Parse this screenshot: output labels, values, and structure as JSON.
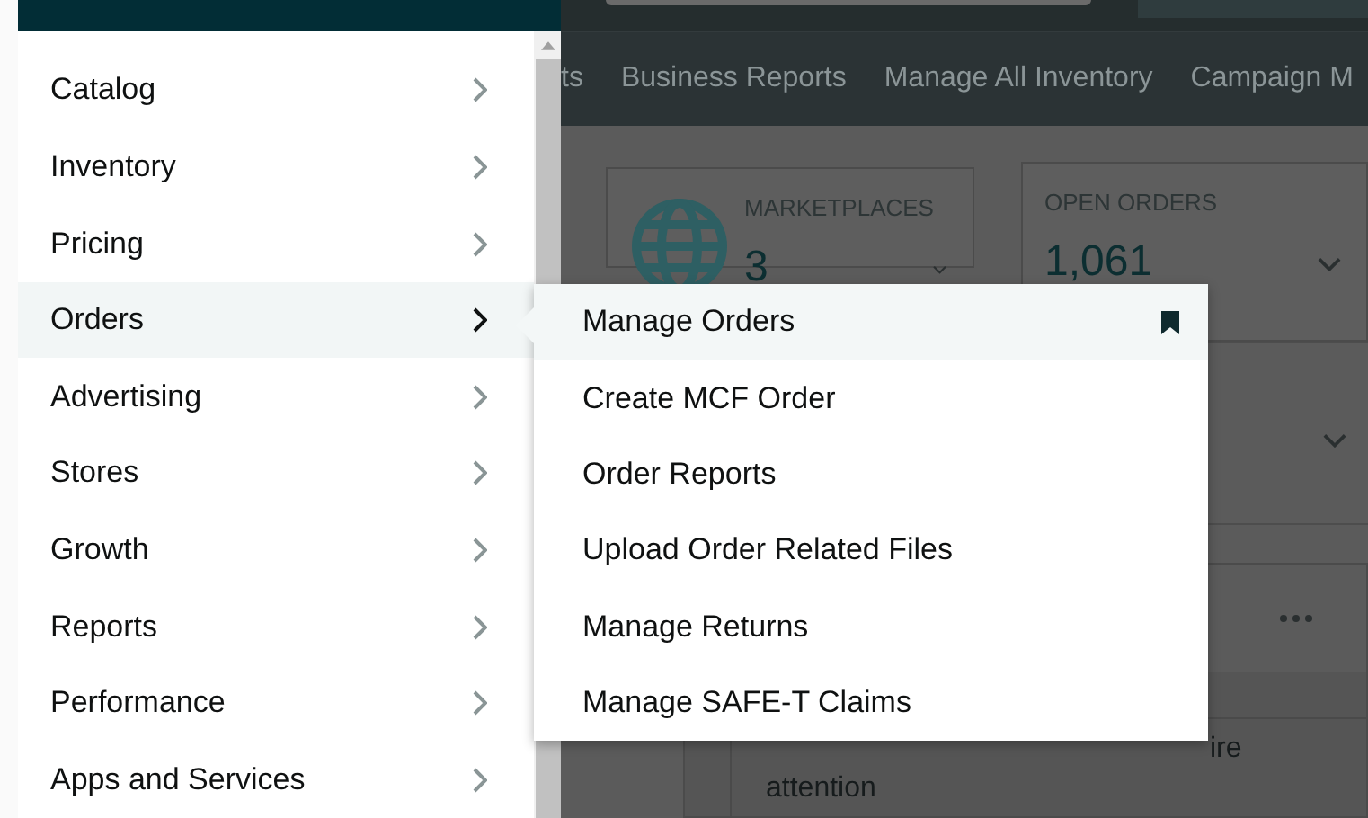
{
  "nav_bar": {
    "items": [
      "ts",
      "Business Reports",
      "Manage All Inventory",
      "Campaign M"
    ]
  },
  "cards": [
    {
      "label": "MARKETPLACES",
      "value": "3",
      "kind": "globe"
    },
    {
      "label": "OPEN ORDERS",
      "value": "1,061",
      "kind": "plain"
    }
  ],
  "alert_card": {
    "lines": [
      "ire",
      "attention"
    ]
  },
  "menu": {
    "items": [
      {
        "label": "Catalog",
        "selected": false
      },
      {
        "label": "Inventory",
        "selected": false
      },
      {
        "label": "Pricing",
        "selected": false
      },
      {
        "label": "Orders",
        "selected": true
      },
      {
        "label": "Advertising",
        "selected": false
      },
      {
        "label": "Stores",
        "selected": false
      },
      {
        "label": "Growth",
        "selected": false
      },
      {
        "label": "Reports",
        "selected": false
      },
      {
        "label": "Performance",
        "selected": false
      },
      {
        "label": "Apps and Services",
        "selected": false
      }
    ]
  },
  "submenu": {
    "items": [
      {
        "label": "Manage Orders",
        "selected": true
      },
      {
        "label": "Create MCF Order",
        "selected": false
      },
      {
        "label": "Order Reports",
        "selected": false
      },
      {
        "label": "Upload Order Related Files",
        "selected": false
      },
      {
        "label": "Manage Returns",
        "selected": false
      },
      {
        "label": "Manage SAFE-T Claims",
        "selected": false
      }
    ]
  }
}
